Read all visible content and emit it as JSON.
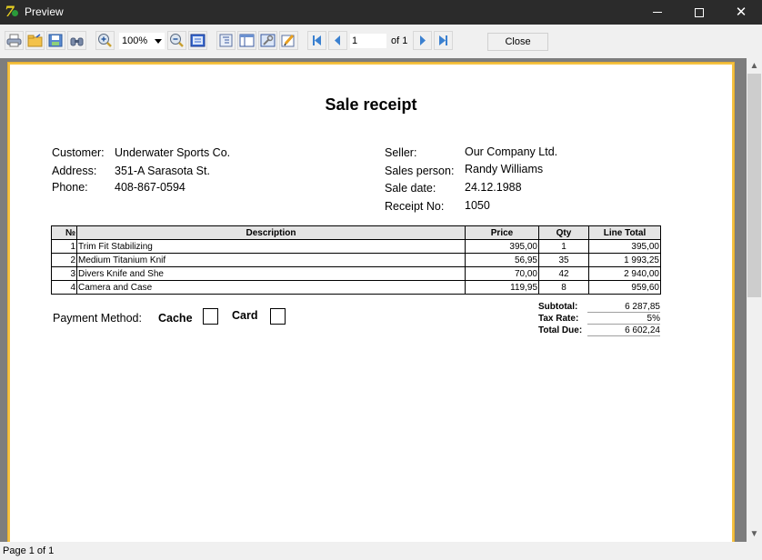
{
  "window": {
    "title": "Preview"
  },
  "toolbar": {
    "buttons": [
      "print-icon",
      "open-icon",
      "save-icon",
      "find-icon",
      "zoom-in-icon",
      "zoom-out-icon",
      "whole-page-icon",
      "outline-icon",
      "thumbnails-icon",
      "page-setup-icon",
      "edit-icon",
      "first-page-icon",
      "prev-page-icon",
      "next-page-icon",
      "last-page-icon"
    ],
    "zoom_value": "100%",
    "page_value": "1",
    "page_of": "of 1",
    "close_label": "Close"
  },
  "status": {
    "text": "Page 1 of 1"
  },
  "receipt": {
    "title": "Sale receipt",
    "customer": {
      "customer_label": "Customer:",
      "customer_value": "Underwater Sports Co.",
      "address_label": "Address:",
      "address_value": "351-A Sarasota St.",
      "phone_label": "Phone:",
      "phone_value": "408-867-0594"
    },
    "seller": {
      "seller_label": "Seller:",
      "seller_value": "Our Company Ltd.",
      "person_label": "Sales person:",
      "person_value": "Randy Williams",
      "date_label": "Sale date:",
      "date_value": "24.12.1988",
      "receipt_label": "Receipt No:",
      "receipt_value": "1050"
    },
    "table": {
      "headers": [
        "№",
        "Description",
        "Price",
        "Qty",
        "Line Total"
      ],
      "rows": [
        [
          "1",
          "Trim Fit Stabilizing",
          "395,00",
          "1",
          "395,00"
        ],
        [
          "2",
          "Medium Titanium Knif",
          "56,95",
          "35",
          "1 993,25"
        ],
        [
          "3",
          "Divers Knife and She",
          "70,00",
          "42",
          "2 940,00"
        ],
        [
          "4",
          "Camera and Case",
          "119,95",
          "8",
          "959,60"
        ]
      ]
    },
    "totals": {
      "subtotal_label": "Subtotal:",
      "subtotal_value": "6 287,85",
      "tax_label": "Tax Rate:",
      "tax_value": "5%",
      "due_label": "Total Due:",
      "due_value": "6 602,24"
    },
    "payment": {
      "label": "Payment Method:",
      "cache_label": "Cache",
      "card_label": "Card",
      "cache_checked": false,
      "card_checked": false
    }
  }
}
